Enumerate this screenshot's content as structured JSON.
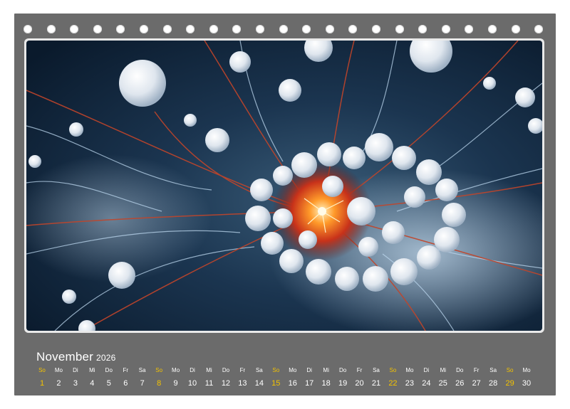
{
  "calendar": {
    "month": "November",
    "year": "2026",
    "accent_color": "#f4c300",
    "background_color": "#6b6b6b",
    "days": [
      {
        "weekday": "So",
        "day": "1",
        "sunday": true
      },
      {
        "weekday": "Mo",
        "day": "2"
      },
      {
        "weekday": "Di",
        "day": "3"
      },
      {
        "weekday": "Mi",
        "day": "4"
      },
      {
        "weekday": "Do",
        "day": "5"
      },
      {
        "weekday": "Fr",
        "day": "6"
      },
      {
        "weekday": "Sa",
        "day": "7"
      },
      {
        "weekday": "So",
        "day": "8",
        "sunday": true
      },
      {
        "weekday": "Mo",
        "day": "9"
      },
      {
        "weekday": "Di",
        "day": "10"
      },
      {
        "weekday": "Mi",
        "day": "11"
      },
      {
        "weekday": "Do",
        "day": "12"
      },
      {
        "weekday": "Fr",
        "day": "13"
      },
      {
        "weekday": "Sa",
        "day": "14"
      },
      {
        "weekday": "So",
        "day": "15",
        "sunday": true
      },
      {
        "weekday": "Mo",
        "day": "16"
      },
      {
        "weekday": "Di",
        "day": "17"
      },
      {
        "weekday": "Mi",
        "day": "18"
      },
      {
        "weekday": "Do",
        "day": "19"
      },
      {
        "weekday": "Fr",
        "day": "20"
      },
      {
        "weekday": "Sa",
        "day": "21"
      },
      {
        "weekday": "So",
        "day": "22",
        "sunday": true
      },
      {
        "weekday": "Mo",
        "day": "23"
      },
      {
        "weekday": "Di",
        "day": "24"
      },
      {
        "weekday": "Mi",
        "day": "25"
      },
      {
        "weekday": "Do",
        "day": "26"
      },
      {
        "weekday": "Fr",
        "day": "27"
      },
      {
        "weekday": "Sa",
        "day": "28"
      },
      {
        "weekday": "So",
        "day": "29",
        "sunday": true
      },
      {
        "weekday": "Mo",
        "day": "30"
      }
    ]
  }
}
